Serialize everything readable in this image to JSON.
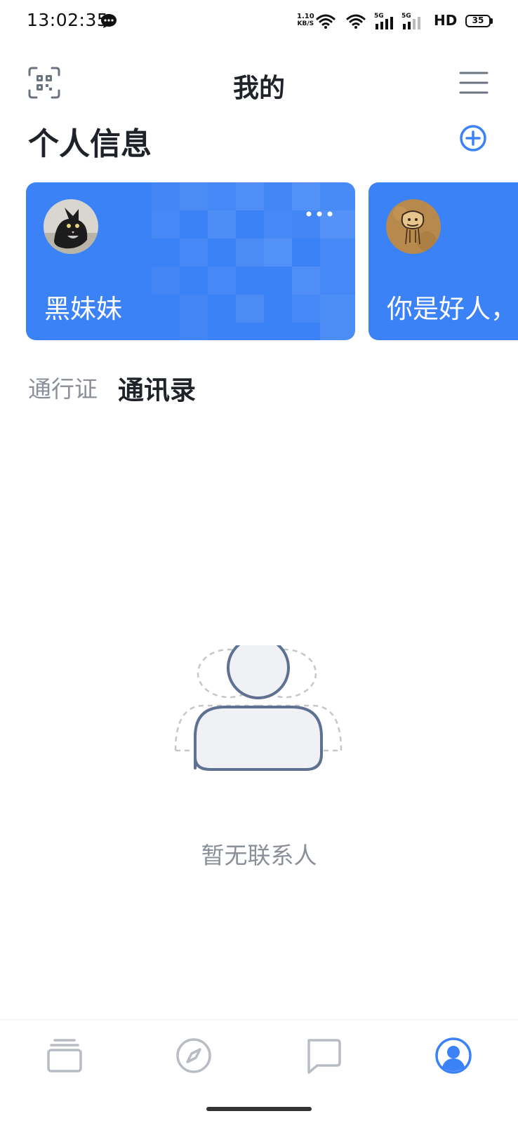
{
  "status_bar": {
    "time": "13:02:35",
    "net_speed_value": "1.10",
    "net_speed_unit": "KB/S",
    "signal_label_1": "5G",
    "signal_label_2": "5G",
    "hd_label": "HD",
    "battery_level": "35",
    "icons": [
      "message-bubble-icon",
      "wifi-icon",
      "wifi-icon",
      "signal-5g-icon",
      "signal-5g-icon",
      "battery-icon"
    ]
  },
  "header": {
    "title": "我的",
    "scan_icon": "qr-scan-icon",
    "menu_icon": "hamburger-menu-icon"
  },
  "personal_info": {
    "title": "个人信息",
    "add_icon": "plus-circle-icon",
    "cards": [
      {
        "name": "黑妹妹",
        "avatar": "cat-photo",
        "has_more": true
      },
      {
        "name": "你是好人，",
        "avatar": "cartoon-doodle"
      }
    ]
  },
  "tabs": {
    "items": [
      {
        "label": "通行证",
        "active": false
      },
      {
        "label": "通讯录",
        "active": true
      }
    ]
  },
  "empty_state": {
    "text": "暂无联系人",
    "icon": "contacts-empty-icon"
  },
  "bottom_nav": {
    "items": [
      {
        "icon": "wallet-cards-icon",
        "active": false
      },
      {
        "icon": "compass-icon",
        "active": false
      },
      {
        "icon": "chat-bubble-icon",
        "active": false
      },
      {
        "icon": "profile-icon",
        "active": true
      }
    ]
  },
  "colors": {
    "accent": "#3b82f6",
    "text_primary": "#1f2329",
    "text_secondary": "#8a8f99",
    "nav_inactive": "#b8bcc4"
  }
}
